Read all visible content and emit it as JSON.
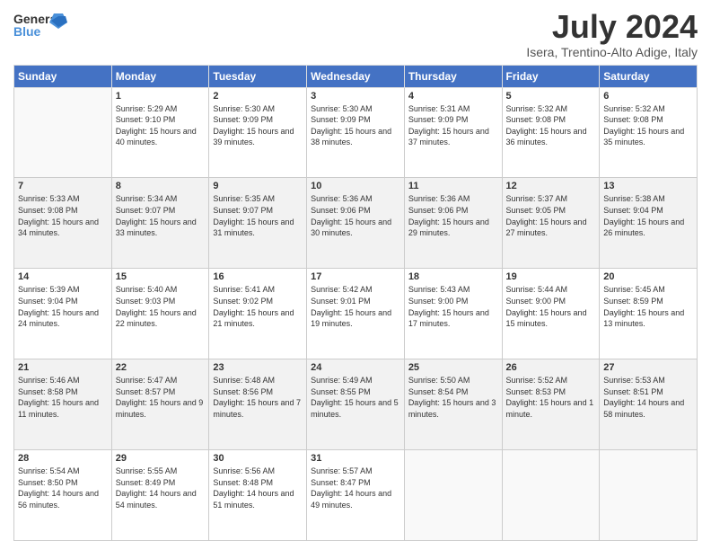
{
  "header": {
    "logo_general": "General",
    "logo_blue": "Blue",
    "month_year": "July 2024",
    "location": "Isera, Trentino-Alto Adige, Italy"
  },
  "days_of_week": [
    "Sunday",
    "Monday",
    "Tuesday",
    "Wednesday",
    "Thursday",
    "Friday",
    "Saturday"
  ],
  "weeks": [
    [
      {
        "day": "",
        "sunrise": "",
        "sunset": "",
        "daylight": ""
      },
      {
        "day": "1",
        "sunrise": "Sunrise: 5:29 AM",
        "sunset": "Sunset: 9:10 PM",
        "daylight": "Daylight: 15 hours and 40 minutes."
      },
      {
        "day": "2",
        "sunrise": "Sunrise: 5:30 AM",
        "sunset": "Sunset: 9:09 PM",
        "daylight": "Daylight: 15 hours and 39 minutes."
      },
      {
        "day": "3",
        "sunrise": "Sunrise: 5:30 AM",
        "sunset": "Sunset: 9:09 PM",
        "daylight": "Daylight: 15 hours and 38 minutes."
      },
      {
        "day": "4",
        "sunrise": "Sunrise: 5:31 AM",
        "sunset": "Sunset: 9:09 PM",
        "daylight": "Daylight: 15 hours and 37 minutes."
      },
      {
        "day": "5",
        "sunrise": "Sunrise: 5:32 AM",
        "sunset": "Sunset: 9:08 PM",
        "daylight": "Daylight: 15 hours and 36 minutes."
      },
      {
        "day": "6",
        "sunrise": "Sunrise: 5:32 AM",
        "sunset": "Sunset: 9:08 PM",
        "daylight": "Daylight: 15 hours and 35 minutes."
      }
    ],
    [
      {
        "day": "7",
        "sunrise": "Sunrise: 5:33 AM",
        "sunset": "Sunset: 9:08 PM",
        "daylight": "Daylight: 15 hours and 34 minutes."
      },
      {
        "day": "8",
        "sunrise": "Sunrise: 5:34 AM",
        "sunset": "Sunset: 9:07 PM",
        "daylight": "Daylight: 15 hours and 33 minutes."
      },
      {
        "day": "9",
        "sunrise": "Sunrise: 5:35 AM",
        "sunset": "Sunset: 9:07 PM",
        "daylight": "Daylight: 15 hours and 31 minutes."
      },
      {
        "day": "10",
        "sunrise": "Sunrise: 5:36 AM",
        "sunset": "Sunset: 9:06 PM",
        "daylight": "Daylight: 15 hours and 30 minutes."
      },
      {
        "day": "11",
        "sunrise": "Sunrise: 5:36 AM",
        "sunset": "Sunset: 9:06 PM",
        "daylight": "Daylight: 15 hours and 29 minutes."
      },
      {
        "day": "12",
        "sunrise": "Sunrise: 5:37 AM",
        "sunset": "Sunset: 9:05 PM",
        "daylight": "Daylight: 15 hours and 27 minutes."
      },
      {
        "day": "13",
        "sunrise": "Sunrise: 5:38 AM",
        "sunset": "Sunset: 9:04 PM",
        "daylight": "Daylight: 15 hours and 26 minutes."
      }
    ],
    [
      {
        "day": "14",
        "sunrise": "Sunrise: 5:39 AM",
        "sunset": "Sunset: 9:04 PM",
        "daylight": "Daylight: 15 hours and 24 minutes."
      },
      {
        "day": "15",
        "sunrise": "Sunrise: 5:40 AM",
        "sunset": "Sunset: 9:03 PM",
        "daylight": "Daylight: 15 hours and 22 minutes."
      },
      {
        "day": "16",
        "sunrise": "Sunrise: 5:41 AM",
        "sunset": "Sunset: 9:02 PM",
        "daylight": "Daylight: 15 hours and 21 minutes."
      },
      {
        "day": "17",
        "sunrise": "Sunrise: 5:42 AM",
        "sunset": "Sunset: 9:01 PM",
        "daylight": "Daylight: 15 hours and 19 minutes."
      },
      {
        "day": "18",
        "sunrise": "Sunrise: 5:43 AM",
        "sunset": "Sunset: 9:00 PM",
        "daylight": "Daylight: 15 hours and 17 minutes."
      },
      {
        "day": "19",
        "sunrise": "Sunrise: 5:44 AM",
        "sunset": "Sunset: 9:00 PM",
        "daylight": "Daylight: 15 hours and 15 minutes."
      },
      {
        "day": "20",
        "sunrise": "Sunrise: 5:45 AM",
        "sunset": "Sunset: 8:59 PM",
        "daylight": "Daylight: 15 hours and 13 minutes."
      }
    ],
    [
      {
        "day": "21",
        "sunrise": "Sunrise: 5:46 AM",
        "sunset": "Sunset: 8:58 PM",
        "daylight": "Daylight: 15 hours and 11 minutes."
      },
      {
        "day": "22",
        "sunrise": "Sunrise: 5:47 AM",
        "sunset": "Sunset: 8:57 PM",
        "daylight": "Daylight: 15 hours and 9 minutes."
      },
      {
        "day": "23",
        "sunrise": "Sunrise: 5:48 AM",
        "sunset": "Sunset: 8:56 PM",
        "daylight": "Daylight: 15 hours and 7 minutes."
      },
      {
        "day": "24",
        "sunrise": "Sunrise: 5:49 AM",
        "sunset": "Sunset: 8:55 PM",
        "daylight": "Daylight: 15 hours and 5 minutes."
      },
      {
        "day": "25",
        "sunrise": "Sunrise: 5:50 AM",
        "sunset": "Sunset: 8:54 PM",
        "daylight": "Daylight: 15 hours and 3 minutes."
      },
      {
        "day": "26",
        "sunrise": "Sunrise: 5:52 AM",
        "sunset": "Sunset: 8:53 PM",
        "daylight": "Daylight: 15 hours and 1 minute."
      },
      {
        "day": "27",
        "sunrise": "Sunrise: 5:53 AM",
        "sunset": "Sunset: 8:51 PM",
        "daylight": "Daylight: 14 hours and 58 minutes."
      }
    ],
    [
      {
        "day": "28",
        "sunrise": "Sunrise: 5:54 AM",
        "sunset": "Sunset: 8:50 PM",
        "daylight": "Daylight: 14 hours and 56 minutes."
      },
      {
        "day": "29",
        "sunrise": "Sunrise: 5:55 AM",
        "sunset": "Sunset: 8:49 PM",
        "daylight": "Daylight: 14 hours and 54 minutes."
      },
      {
        "day": "30",
        "sunrise": "Sunrise: 5:56 AM",
        "sunset": "Sunset: 8:48 PM",
        "daylight": "Daylight: 14 hours and 51 minutes."
      },
      {
        "day": "31",
        "sunrise": "Sunrise: 5:57 AM",
        "sunset": "Sunset: 8:47 PM",
        "daylight": "Daylight: 14 hours and 49 minutes."
      },
      {
        "day": "",
        "sunrise": "",
        "sunset": "",
        "daylight": ""
      },
      {
        "day": "",
        "sunrise": "",
        "sunset": "",
        "daylight": ""
      },
      {
        "day": "",
        "sunrise": "",
        "sunset": "",
        "daylight": ""
      }
    ]
  ]
}
